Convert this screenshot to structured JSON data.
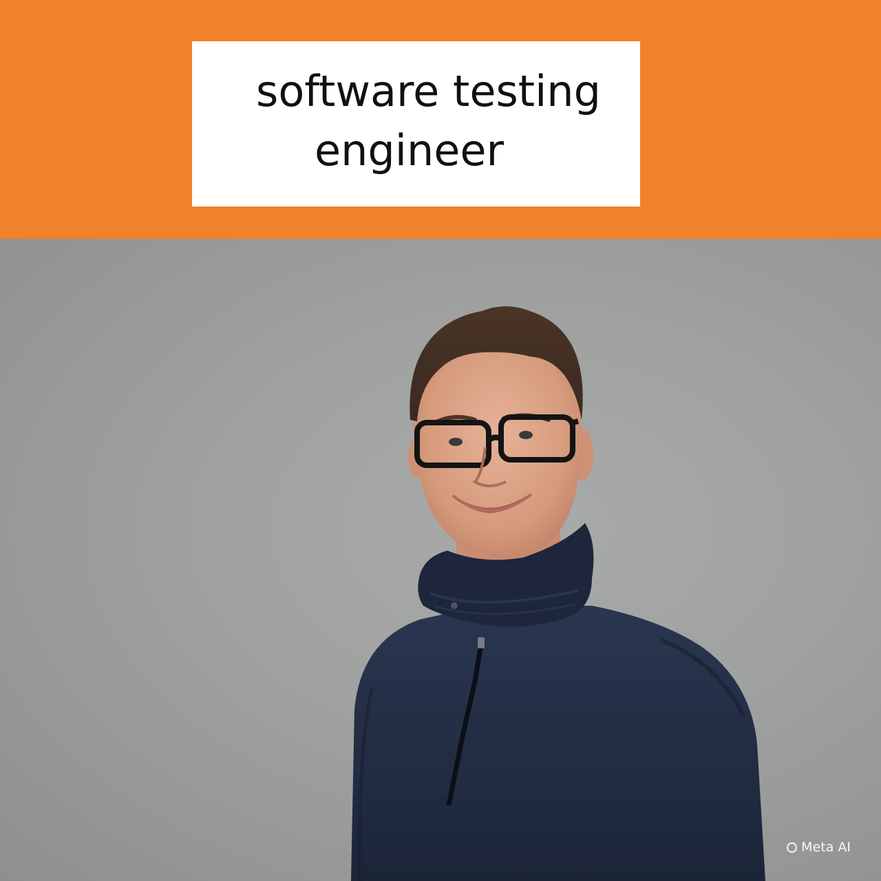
{
  "banner": {
    "title_line_1": "software testing",
    "title_line_2": "engineer",
    "background_color": "#f0822b",
    "card_color": "#ffffff"
  },
  "photo": {
    "subject": "portrait-photo",
    "backdrop_color": "#a0a2a1"
  },
  "watermark": {
    "label": "Meta AI",
    "icon": "meta-ai-ring-icon"
  }
}
